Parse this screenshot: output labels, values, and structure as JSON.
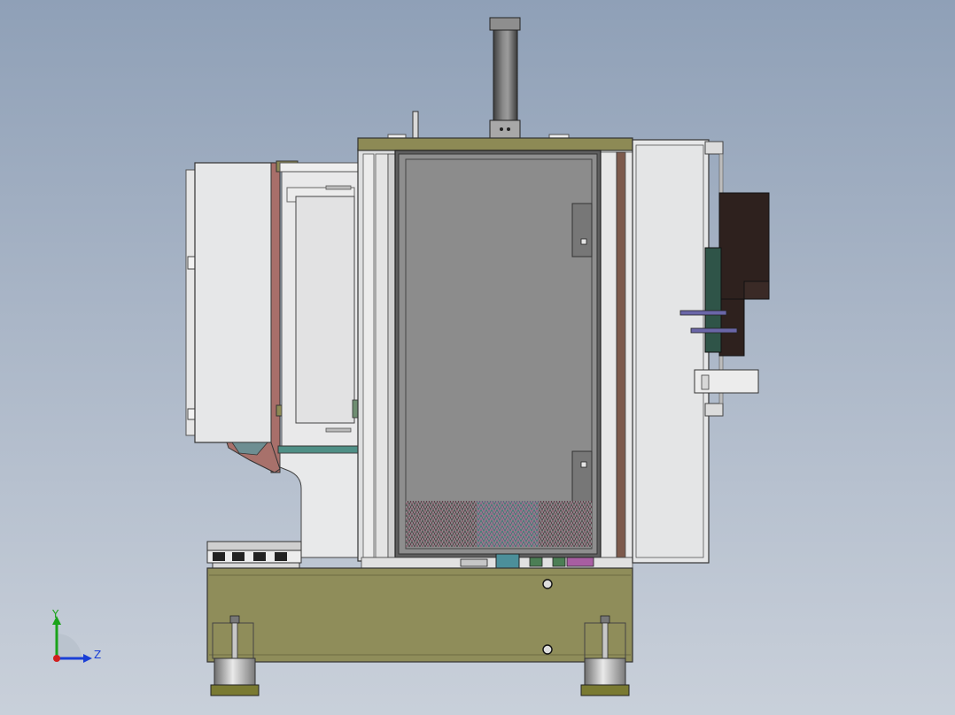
{
  "viewport": {
    "background_top": "#8fa0b7",
    "background_bottom": "#c9d0da"
  },
  "model": {
    "colors": {
      "base_olive": "#8f8d5a",
      "top_plate_olive": "#8d8a55",
      "chamber_gray": "#8e8e8e",
      "panel_white": "#e4e5e6",
      "brown_strip": "#7d5a4c",
      "dark_box": "#2e211e",
      "teal_bracket": "#3e7d73",
      "purple_rod": "#5a5e9e",
      "pink_bracket": "#a5756d"
    }
  },
  "triad": {
    "y_label": "Y",
    "z_label": "Z",
    "y_color": "#1aa31a",
    "z_color": "#1a3fd6",
    "origin_color": "#d11f1f"
  }
}
